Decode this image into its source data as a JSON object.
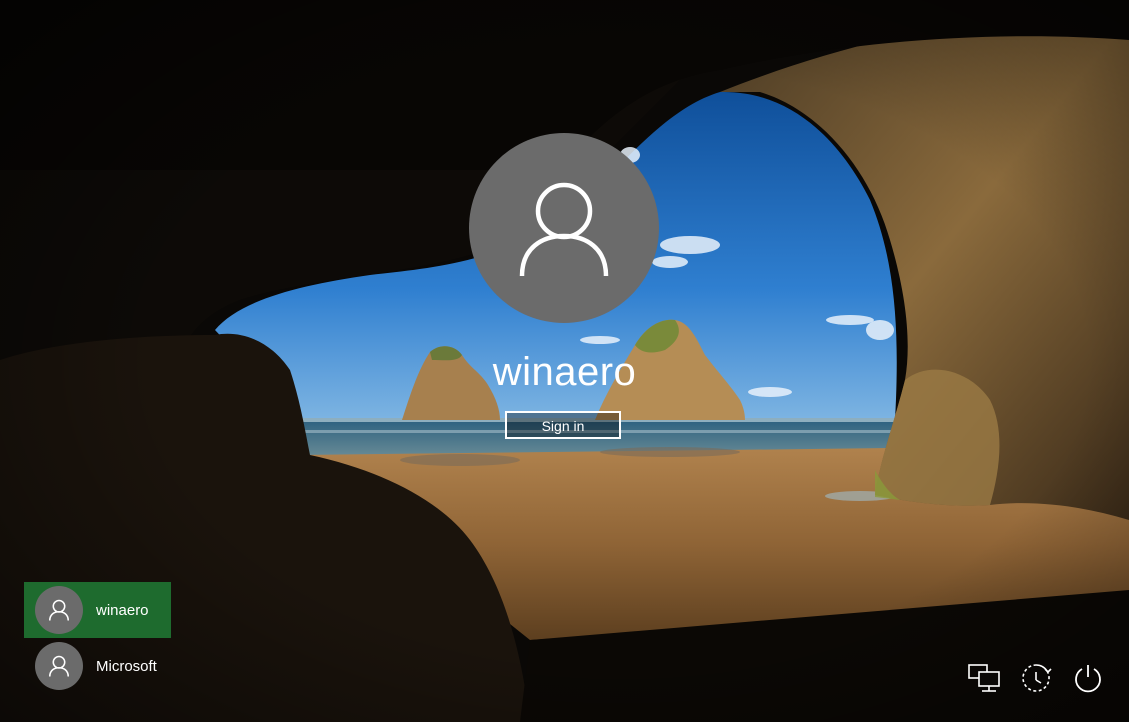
{
  "login": {
    "current_user": "winaero",
    "sign_in_label": "Sign in"
  },
  "users": [
    {
      "name": "winaero",
      "selected": true
    },
    {
      "name": "Microsoft",
      "selected": false
    }
  ],
  "system_icons": [
    "network-icon",
    "ease-of-access-icon",
    "power-icon"
  ],
  "colors": {
    "avatar_gray": "#6b6b6b",
    "selected_user_bg": "#1e6b2e"
  }
}
